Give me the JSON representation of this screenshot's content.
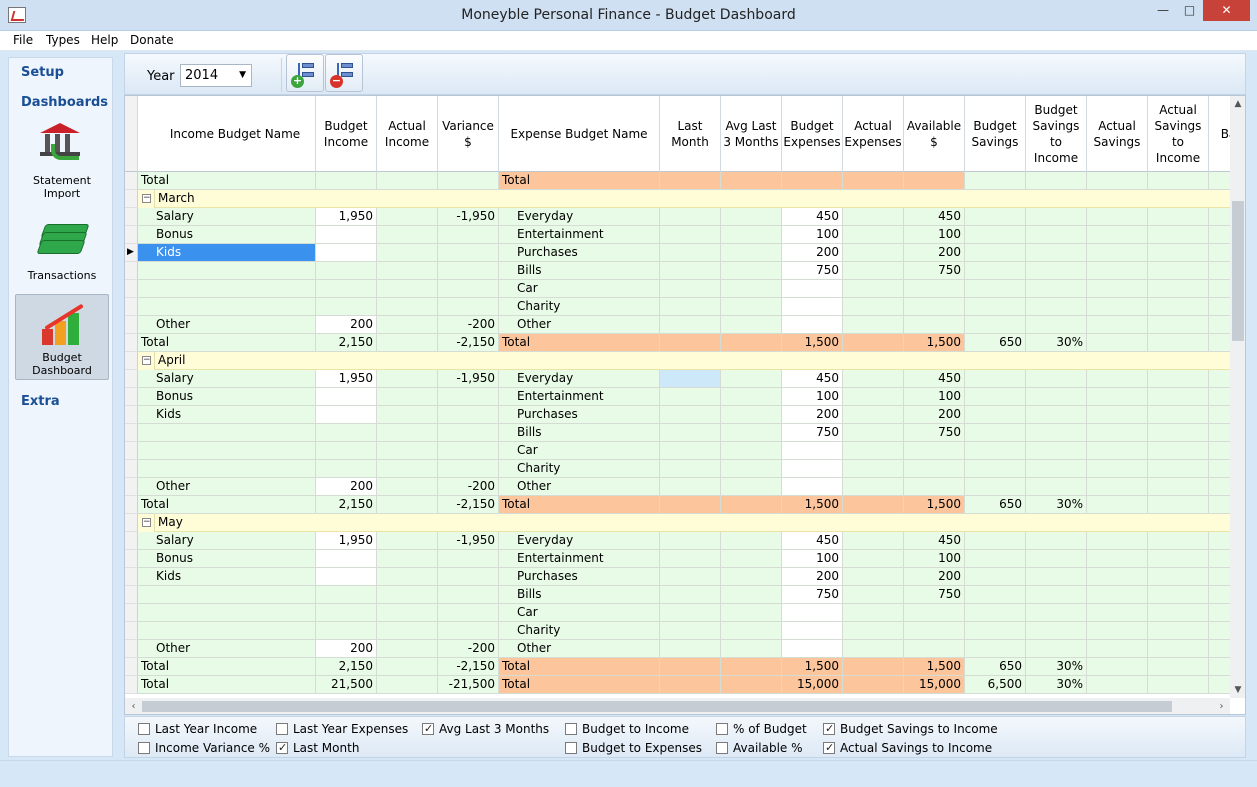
{
  "window": {
    "title": "Moneyble Personal Finance - Budget Dashboard",
    "minimize": "—",
    "maximize": "□",
    "close": "✕"
  },
  "menu": [
    "File",
    "Types",
    "Help",
    "Donate"
  ],
  "sidebar": {
    "setup": "Setup",
    "dashboards": "Dashboards",
    "statement_import": [
      "Statement",
      "Import"
    ],
    "transactions": "Transactions",
    "budget_dashboard": [
      "Budget",
      "Dashboard"
    ],
    "extra": "Extra"
  },
  "toolbar": {
    "year_label": "Year",
    "year_value": "2014"
  },
  "columns": [
    "Income Budget Name",
    "Budget Income",
    "Actual Income",
    "Variance $",
    "Expense Budget Name",
    "Last Month",
    "Avg Last 3 Months",
    "Budget Expenses",
    "Actual Expenses",
    "Available $",
    "Budget Savings",
    "Budget Savings to Income",
    "Actual Savings",
    "Actual Savings to Income",
    "Ba"
  ],
  "top_total": {
    "income_name": "Total",
    "expense_name": "Total"
  },
  "months": [
    {
      "name": "March",
      "rows": [
        {
          "inc": "Salary",
          "bi": "1,950",
          "var": "-1,950",
          "exp": "Everyday",
          "be": "450",
          "av": "450"
        },
        {
          "inc": "Bonus",
          "bi": "",
          "var": "",
          "exp": "Entertainment",
          "be": "100",
          "av": "100"
        },
        {
          "inc": "Kids",
          "bi": "",
          "var": "",
          "exp": "Purchases",
          "be": "200",
          "av": "200"
        },
        {
          "inc": "",
          "bi": "",
          "var": "",
          "exp": "Bills",
          "be": "750",
          "av": "750"
        },
        {
          "inc": "",
          "bi": "",
          "var": "",
          "exp": "Car",
          "be": "",
          "av": ""
        },
        {
          "inc": "",
          "bi": "",
          "var": "",
          "exp": "Charity",
          "be": "",
          "av": ""
        },
        {
          "inc": "Other",
          "bi": "200",
          "var": "-200",
          "exp": "Other",
          "be": "",
          "av": ""
        }
      ],
      "total": {
        "inc": "Total",
        "bi": "2,150",
        "var": "-2,150",
        "exp": "Total",
        "be": "1,500",
        "av": "1,500",
        "bs": "650",
        "bsi": "30%"
      }
    },
    {
      "name": "April",
      "rows": [
        {
          "inc": "Salary",
          "bi": "1,950",
          "var": "-1,950",
          "exp": "Everyday",
          "be": "450",
          "av": "450"
        },
        {
          "inc": "Bonus",
          "bi": "",
          "var": "",
          "exp": "Entertainment",
          "be": "100",
          "av": "100"
        },
        {
          "inc": "Kids",
          "bi": "",
          "var": "",
          "exp": "Purchases",
          "be": "200",
          "av": "200"
        },
        {
          "inc": "",
          "bi": "",
          "var": "",
          "exp": "Bills",
          "be": "750",
          "av": "750"
        },
        {
          "inc": "",
          "bi": "",
          "var": "",
          "exp": "Car",
          "be": "",
          "av": ""
        },
        {
          "inc": "",
          "bi": "",
          "var": "",
          "exp": "Charity",
          "be": "",
          "av": ""
        },
        {
          "inc": "Other",
          "bi": "200",
          "var": "-200",
          "exp": "Other",
          "be": "",
          "av": ""
        }
      ],
      "total": {
        "inc": "Total",
        "bi": "2,150",
        "var": "-2,150",
        "exp": "Total",
        "be": "1,500",
        "av": "1,500",
        "bs": "650",
        "bsi": "30%"
      }
    },
    {
      "name": "May",
      "rows": [
        {
          "inc": "Salary",
          "bi": "1,950",
          "var": "-1,950",
          "exp": "Everyday",
          "be": "450",
          "av": "450"
        },
        {
          "inc": "Bonus",
          "bi": "",
          "var": "",
          "exp": "Entertainment",
          "be": "100",
          "av": "100"
        },
        {
          "inc": "Kids",
          "bi": "",
          "var": "",
          "exp": "Purchases",
          "be": "200",
          "av": "200"
        },
        {
          "inc": "",
          "bi": "",
          "var": "",
          "exp": "Bills",
          "be": "750",
          "av": "750"
        },
        {
          "inc": "",
          "bi": "",
          "var": "",
          "exp": "Car",
          "be": "",
          "av": ""
        },
        {
          "inc": "",
          "bi": "",
          "var": "",
          "exp": "Charity",
          "be": "",
          "av": ""
        },
        {
          "inc": "Other",
          "bi": "200",
          "var": "-200",
          "exp": "Other",
          "be": "",
          "av": ""
        }
      ],
      "total": {
        "inc": "Total",
        "bi": "2,150",
        "var": "-2,150",
        "exp": "Total",
        "be": "1,500",
        "av": "1,500",
        "bs": "650",
        "bsi": "30%"
      }
    }
  ],
  "grand_total": {
    "inc": "Total",
    "bi": "21,500",
    "var": "-21,500",
    "exp": "Total",
    "be": "15,000",
    "av": "15,000",
    "bs": "6,500",
    "bsi": "30%"
  },
  "options": [
    {
      "label": "Last Year Income",
      "checked": false
    },
    {
      "label": "Income Variance %",
      "checked": false
    },
    {
      "label": "Last Year Expenses",
      "checked": false
    },
    {
      "label": "Last Month",
      "checked": true
    },
    {
      "label": "Avg Last 3 Months",
      "checked": true
    },
    {
      "label": "Budget to Income",
      "checked": false
    },
    {
      "label": "Budget to Expenses",
      "checked": false
    },
    {
      "label": "% of Budget",
      "checked": false
    },
    {
      "label": "Available %",
      "checked": false
    },
    {
      "label": "Budget Savings to Income",
      "checked": true
    },
    {
      "label": "Actual Savings to Income",
      "checked": true
    }
  ],
  "colors": {
    "green": "#e8fbe6",
    "orange": "#fcc59b",
    "group_yellow": "#fffcd8",
    "selection": "#3b91ee",
    "accent": "#1a4f95"
  }
}
